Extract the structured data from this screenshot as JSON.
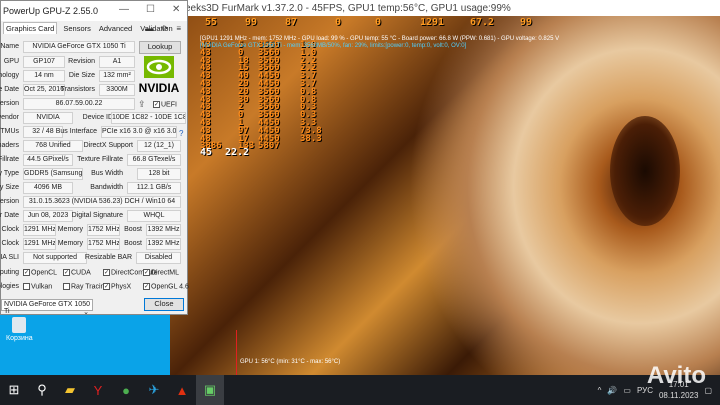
{
  "furmark": {
    "title": "eeks3D FurMark v1.37.2.0 - 45FPS, GPU1 temp:56°C, GPU1 usage:99%",
    "osd_top": [
      "55",
      "99",
      "87",
      "0",
      "0",
      "1291",
      "67.2",
      "99"
    ],
    "info_lines": [
      "[GPU1 1291 MHz - mem: 1752 MHz - GPU load: 99 % - GPU temp: 55 °C - Board power: 66.8 W (PPW: 0.681) - GPU voltage: 0.825 V",
      "[NVIDIA GeForce GTX 1050 Ti - mem: 3560MB/50%, fan: 29%, limits:[power:0, temp:0, volt:0, OV:0]"
    ],
    "rows": [
      [
        "43",
        "5",
        "3560",
        "1.0"
      ],
      [
        "43",
        "0",
        "3560",
        "1.0"
      ],
      [
        "43",
        "18",
        "3560",
        "2.2"
      ],
      [
        "43",
        "15",
        "3560",
        "2.2"
      ],
      [
        "43",
        "40",
        "4450",
        "3.7"
      ],
      [
        "43",
        "29",
        "4450",
        "3.7"
      ],
      [
        "43",
        "20",
        "3560",
        "0.8"
      ],
      [
        "43",
        "30",
        "3560",
        "0.8"
      ],
      [
        "43",
        "2",
        "3560",
        "0.3"
      ],
      [
        "43",
        "0",
        "3560",
        "0.3"
      ],
      [
        "43",
        "1",
        "4450",
        "3.3"
      ],
      [
        "43",
        "97",
        "4450",
        "73.8"
      ],
      [
        "48",
        "17",
        "4450",
        "38.3"
      ],
      [
        "3886",
        "133",
        "5807",
        ""
      ]
    ],
    "fps": "45",
    "frametime": "22.2",
    "graph_label": "GPU 1: 56°C (min: 31°C - max: 56°C)"
  },
  "gpuz": {
    "title": "PowerUp GPU-Z 2.55.0",
    "tabs": [
      "Graphics Card",
      "Sensors",
      "Advanced",
      "Validation"
    ],
    "lookup": "Lookup",
    "uefi": "UEFI",
    "close": "Close",
    "gpu_select": "NVIDIA GeForce GTX 1050 Ti",
    "vendor_logo": "NVIDIA",
    "fields": {
      "name_l": "Name",
      "name": "NVIDIA GeForce GTX 1050 Ti",
      "gpu_l": "GPU",
      "gpu": "GP107",
      "rev_l": "Revision",
      "rev": "A1",
      "tech_l": "Technology",
      "tech": "14 nm",
      "die_l": "Die Size",
      "die": "132 mm²",
      "rel_l": "Release Date",
      "rel": "Oct 25, 2016",
      "tr_l": "Transistors",
      "tr": "3300M",
      "bios_l": "BIOS Version",
      "bios": "86.07.59.00.22",
      "sub_l": "Subvendor",
      "sub": "NVIDIA",
      "dev_l": "Device ID",
      "dev": "10DE 1C82 - 10DE 1C82",
      "rops_l": "ROPs/TMUs",
      "rops": "32 / 48",
      "bus_l": "Bus Interface",
      "bus": "PCIe x16 3.0 @ x16 3.0",
      "sh_l": "Shaders",
      "sh": "768 Unified",
      "dx_l": "DirectX Support",
      "dx": "12 (12_1)",
      "pf_l": "Pixel Fillrate",
      "pf": "44.5 GPixel/s",
      "tf_l": "Texture Fillrate",
      "tf": "66.8 GTexel/s",
      "mt_l": "Memory Type",
      "mt": "GDDR5 (Samsung)",
      "bw_l": "Bus Width",
      "bw": "128 bit",
      "ms_l": "Memory Size",
      "ms": "4096 MB",
      "band_l": "Bandwidth",
      "band": "112.1 GB/s",
      "dv_l": "Driver Version",
      "dv": "31.0.15.3623 (NVIDIA 536.23) DCH / Win10 64",
      "dd_l": "Driver Date",
      "dd": "Jun 08, 2023",
      "ds_l": "Digital Signature",
      "ds": "WHQL",
      "gc_l": "GPU Clock",
      "gc": "1291 MHz",
      "mem_l": "Memory",
      "gm": "1752 MHz",
      "boost_l": "Boost",
      "gb": "1392 MHz",
      "dc_l": "Default Clock",
      "dc": "1291 MHz",
      "dm": "1752 MHz",
      "db": "1392 MHz",
      "sli_l": "NVIDIA SLI",
      "sli": "Not supported",
      "rbar_l": "Resizable BAR",
      "rbar": "Disabled",
      "comp_l": "Computing",
      "tech2_l": "Technologies"
    },
    "computing": [
      {
        "label": "OpenCL",
        "checked": true
      },
      {
        "label": "CUDA",
        "checked": true
      },
      {
        "label": "DirectCompute",
        "checked": true
      },
      {
        "label": "DirectML",
        "checked": true
      }
    ],
    "technologies": [
      {
        "label": "Vulkan",
        "checked": false
      },
      {
        "label": "Ray Tracing",
        "checked": false
      },
      {
        "label": "PhysX",
        "checked": true
      },
      {
        "label": "OpenGL 4.6",
        "checked": true
      }
    ]
  },
  "desktop": {
    "recycle_bin": "Корзина"
  },
  "taskbar": {
    "lang": "РУС",
    "time": "17:01",
    "date": "08.11.2023"
  },
  "watermark": "Avito"
}
